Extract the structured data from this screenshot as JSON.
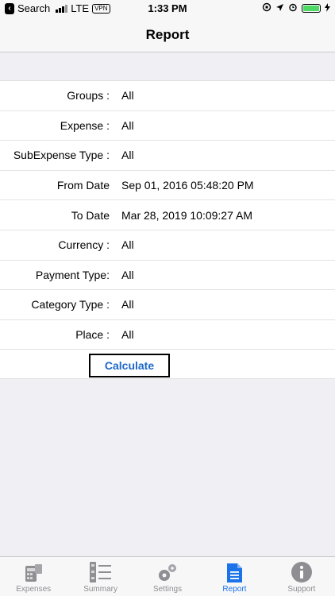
{
  "status_bar": {
    "back_app": "Search",
    "network": "LTE",
    "vpn": "VPN",
    "time": "1:33 PM"
  },
  "nav": {
    "title": "Report"
  },
  "form": {
    "rows": [
      {
        "label": "Groups :",
        "value": "All"
      },
      {
        "label": "Expense :",
        "value": "All"
      },
      {
        "label": "SubExpense Type :",
        "value": "All"
      },
      {
        "label": "From Date",
        "value": "Sep 01, 2016 05:48:20 PM"
      },
      {
        "label": "To Date",
        "value": "Mar 28, 2019 10:09:27 AM"
      },
      {
        "label": "Currency :",
        "value": "All"
      },
      {
        "label": "Payment Type:",
        "value": "All"
      },
      {
        "label": "Category Type :",
        "value": "All"
      },
      {
        "label": "Place :",
        "value": "All"
      }
    ],
    "calculate_label": "Calculate"
  },
  "tabs": [
    {
      "label": "Expenses",
      "icon": "expenses-icon",
      "active": false
    },
    {
      "label": "Summary",
      "icon": "summary-icon",
      "active": false
    },
    {
      "label": "Settings",
      "icon": "settings-icon",
      "active": false
    },
    {
      "label": "Report",
      "icon": "report-icon",
      "active": true
    },
    {
      "label": "Support",
      "icon": "support-icon",
      "active": false
    }
  ],
  "colors": {
    "accent": "#1a73e8",
    "inactive_tab": "#8e8e93",
    "battery": "#4cd964"
  }
}
